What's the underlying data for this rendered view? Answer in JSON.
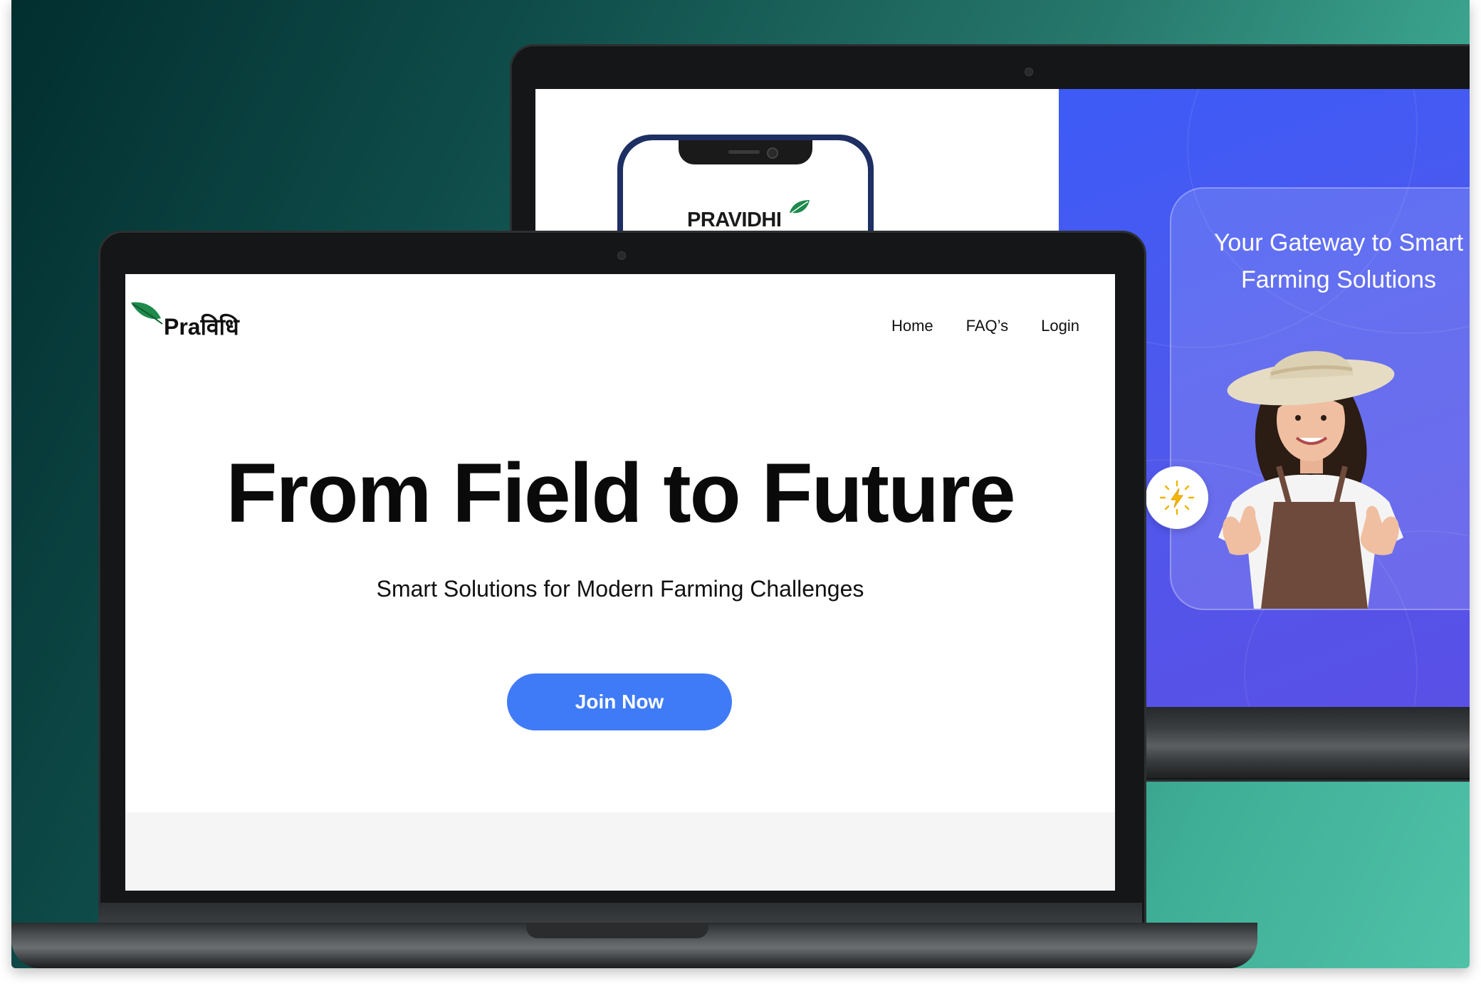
{
  "back_device": {
    "phone_logo": "PRAVIDHI",
    "promo": {
      "title": "Your Gateway to Smart Farming Solutions"
    }
  },
  "front_site": {
    "brand": "Praविधि",
    "nav": {
      "items": [
        "Home",
        "FAQ’s",
        "Login"
      ]
    },
    "hero": {
      "title": "From Field to Future",
      "subtitle": "Smart Solutions for Modern Farming Challenges",
      "cta_label": "Join Now"
    }
  },
  "colors": {
    "primary_blue": "#3f7bf7",
    "promo_gradient_start": "#3d5bf7",
    "promo_gradient_end": "#5a4fe6",
    "leaf_green": "#1e8a4c",
    "background_dark": "#022e2f",
    "background_light": "#4fc2a8"
  },
  "icons": [
    "leaf-icon",
    "lightning-icon"
  ]
}
